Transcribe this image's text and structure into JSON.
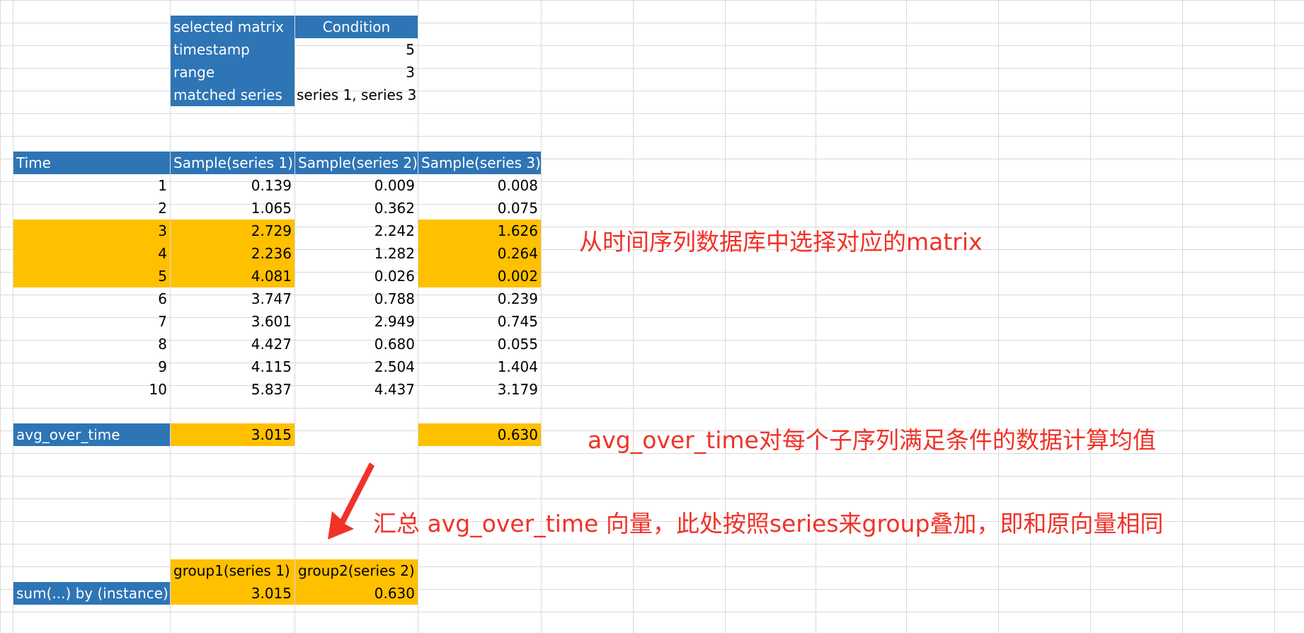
{
  "condition_table": {
    "header": {
      "label": "selected matrix",
      "value": "Condition"
    },
    "rows": [
      {
        "label": "timestamp",
        "value": "5"
      },
      {
        "label": "range",
        "value": "3"
      },
      {
        "label": "matched series",
        "value": "series 1, series 3"
      }
    ]
  },
  "sample_table": {
    "columns": [
      "Time",
      "Sample(series 1)",
      "Sample(series 2)",
      "Sample(series 3)"
    ],
    "rows": [
      [
        "1",
        "0.139",
        "0.009",
        "0.008"
      ],
      [
        "2",
        "1.065",
        "0.362",
        "0.075"
      ],
      [
        "3",
        "2.729",
        "2.242",
        "1.626"
      ],
      [
        "4",
        "2.236",
        "1.282",
        "0.264"
      ],
      [
        "5",
        "4.081",
        "0.026",
        "0.002"
      ],
      [
        "6",
        "3.747",
        "0.788",
        "0.239"
      ],
      [
        "7",
        "3.601",
        "2.949",
        "0.745"
      ],
      [
        "8",
        "4.427",
        "0.680",
        "0.055"
      ],
      [
        "9",
        "4.115",
        "2.504",
        "1.404"
      ],
      [
        "10",
        "5.837",
        "4.437",
        "3.179"
      ]
    ],
    "highlighted_rows": [
      2,
      3,
      4
    ],
    "highlighted_columns": [
      0,
      1,
      3
    ]
  },
  "avg_row": {
    "label": "avg_over_time",
    "series1": "3.015",
    "series3": "0.630"
  },
  "sum_table": {
    "group_headers": [
      "group1(series 1)",
      "group2(series 2)"
    ],
    "label": "sum(...) by (instance)",
    "values": [
      "3.015",
      "0.630"
    ]
  },
  "annotations": {
    "select": "从时间序列数据库中选择对应的matrix",
    "avg": "avg_over_time对每个子序列满足条件的数据计算均值",
    "sum": "汇总 avg_over_time 向量，此处按照series来group叠加，即和原向量相同"
  },
  "colors": {
    "header_blue": "#2e75b6",
    "highlight_yellow": "#ffc000",
    "annotation_red": "#f03228",
    "grid": "#d9d9d9"
  },
  "icons": {
    "arrow": "arrow-down-left-icon"
  }
}
